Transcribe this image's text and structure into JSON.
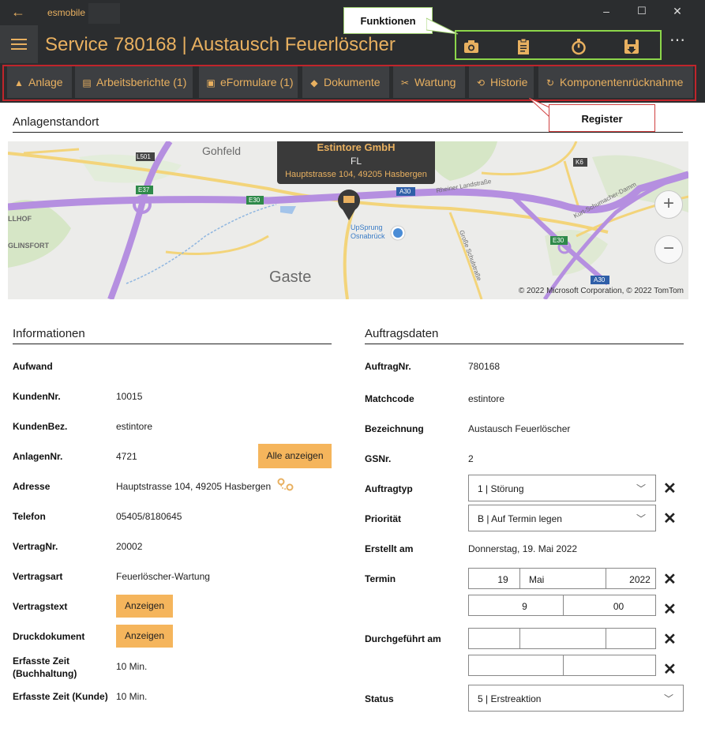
{
  "titlebar": {
    "back_icon": "back-arrow-icon",
    "app_name": "esmobile",
    "minimize": "–",
    "maximize": "☐",
    "close": "✕"
  },
  "header": {
    "title": "Service 780168  |  Austausch Feuerlöscher",
    "functions_callout": "Funktionen",
    "function_icons": [
      "camera-icon",
      "clipboard-icon",
      "stopwatch-icon",
      "save-icon"
    ],
    "more": "⋯"
  },
  "tabs": [
    {
      "label": "Anlage",
      "icon": "▲"
    },
    {
      "label": "Arbeitsberichte (1)",
      "icon": "▤"
    },
    {
      "label": "eFormulare (1)",
      "icon": "▣"
    },
    {
      "label": "Dokumente",
      "icon": "◆"
    },
    {
      "label": "Wartung",
      "icon": "✂"
    },
    {
      "label": "Historie",
      "icon": "⟲"
    },
    {
      "label": "Komponentenrücknahme",
      "icon": "↻"
    }
  ],
  "register_callout": "Register",
  "location": {
    "title": "Anlagenstandort",
    "pin_company": "Estintore GmbH",
    "pin_code": "FL",
    "pin_address": "Hauptstrasse 104, 49205 Hasbergen",
    "places": [
      "Gohfeld",
      "LLHOF",
      "GLINSFORT",
      "Gaste",
      "UpSprung Osnabrück",
      "Rheiner Landstraße",
      "Große Schulstraße",
      "Kurt-Schumacher-Damm"
    ],
    "road_labels": [
      "L501",
      "E37",
      "E30",
      "A30",
      "K6",
      "E30",
      "A30"
    ],
    "zoom_in": "+",
    "zoom_out": "−",
    "copyright": "© 2022 Microsoft Corporation, © 2022 TomTom"
  },
  "info": {
    "title": "Informationen",
    "rows": [
      {
        "label": "Aufwand",
        "value": ""
      },
      {
        "label": "KundenNr.",
        "value": "10015"
      },
      {
        "label": "KundenBez.",
        "value": "estintore"
      },
      {
        "label": "AnlagenNr.",
        "value": "4721"
      },
      {
        "label": "Adresse",
        "value": "Hauptstrasse 104, 49205 Hasbergen"
      },
      {
        "label": "Telefon",
        "value": "05405/8180645"
      },
      {
        "label": "VertragNr.",
        "value": "20002"
      },
      {
        "label": "Vertragsart",
        "value": "Feuerlöscher-Wartung"
      },
      {
        "label": "Vertragstext",
        "value": ""
      },
      {
        "label": "Druckdokument",
        "value": ""
      },
      {
        "label": "Erfasste Zeit (Buchhaltung)",
        "value": "10 Min."
      },
      {
        "label": "Erfasste Zeit (Kunde)",
        "value": "10 Min."
      }
    ],
    "show_all_button": "Alle anzeigen",
    "show_button": "Anzeigen",
    "route_icon": "route-icon"
  },
  "order": {
    "title": "Auftragsdaten",
    "auftragnr_label": "AuftragNr.",
    "auftragnr": "780168",
    "matchcode_label": "Matchcode",
    "matchcode": "estintore",
    "bezeichnung_label": "Bezeichnung",
    "bezeichnung": "Austausch Feuerlöscher",
    "gsnr_label": "GSNr.",
    "gsnr": "2",
    "auftragtyp_label": "Auftragtyp",
    "auftragtyp": "1  |  Störung",
    "prioritaet_label": "Priorität",
    "prioritaet": "B  |  Auf Termin legen",
    "erstellt_label": "Erstellt am",
    "erstellt": "Donnerstag, 19. Mai 2022",
    "termin_label": "Termin",
    "termin_day": "19",
    "termin_month": "Mai",
    "termin_year": "2022",
    "termin_hour": "9",
    "termin_minute": "00",
    "durchgefuehrt_label": "Durchgeführt am",
    "status_label": "Status",
    "status": "5  |  Erstreaktion",
    "clear": "✕",
    "chevron": "﹀"
  }
}
